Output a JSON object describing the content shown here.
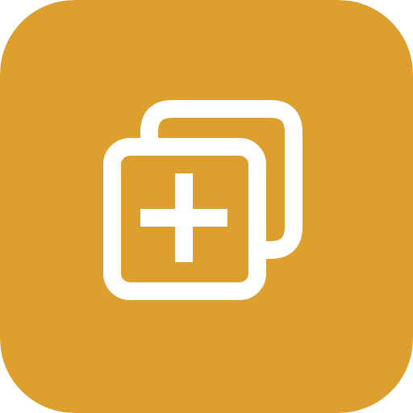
{
  "app_icon": {
    "icon": "duplicate-add-icon",
    "background_color": "#DDA02E",
    "glyph_color": "#FFFFFF"
  }
}
